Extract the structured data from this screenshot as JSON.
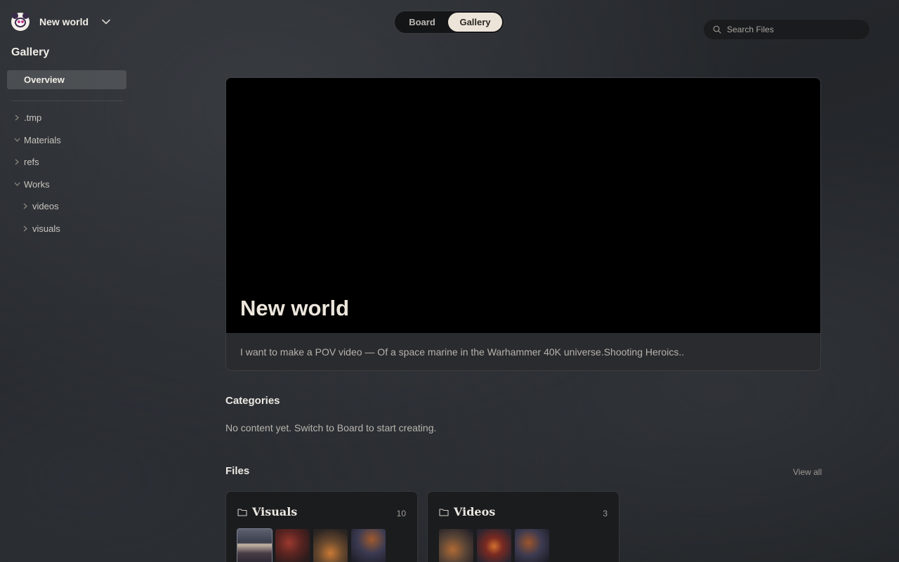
{
  "workspace": {
    "name": "New world",
    "avatar_icon": "panda-avatar-icon"
  },
  "sidebar": {
    "title": "Gallery",
    "overview_label": "Overview",
    "tree": [
      {
        "label": ".tmp",
        "expanded": false,
        "level": 0
      },
      {
        "label": "Materials",
        "expanded": true,
        "level": 0
      },
      {
        "label": "refs",
        "expanded": false,
        "level": 0
      },
      {
        "label": "Works",
        "expanded": true,
        "level": 0
      },
      {
        "label": "videos",
        "expanded": false,
        "level": 1
      },
      {
        "label": "visuals",
        "expanded": false,
        "level": 1
      }
    ]
  },
  "view_toggle": {
    "board": "Board",
    "gallery": "Gallery",
    "active": "Gallery"
  },
  "search": {
    "placeholder": "Search Files"
  },
  "hero": {
    "title": "New world",
    "description": "I want to make a POV video — Of a space marine in the Warhammer 40K universe.Shooting Heroics.."
  },
  "categories": {
    "title": "Categories",
    "empty_text": "No content yet. Switch to Board to start creating."
  },
  "files": {
    "title": "Files",
    "view_all": "View all",
    "folders": [
      {
        "name": "Visuals",
        "count": "10"
      },
      {
        "name": "Videos",
        "count": "3"
      }
    ]
  },
  "colors": {
    "accent_pill": "#ece4d8",
    "background": "#26292d",
    "card": "#1b1c1e"
  }
}
